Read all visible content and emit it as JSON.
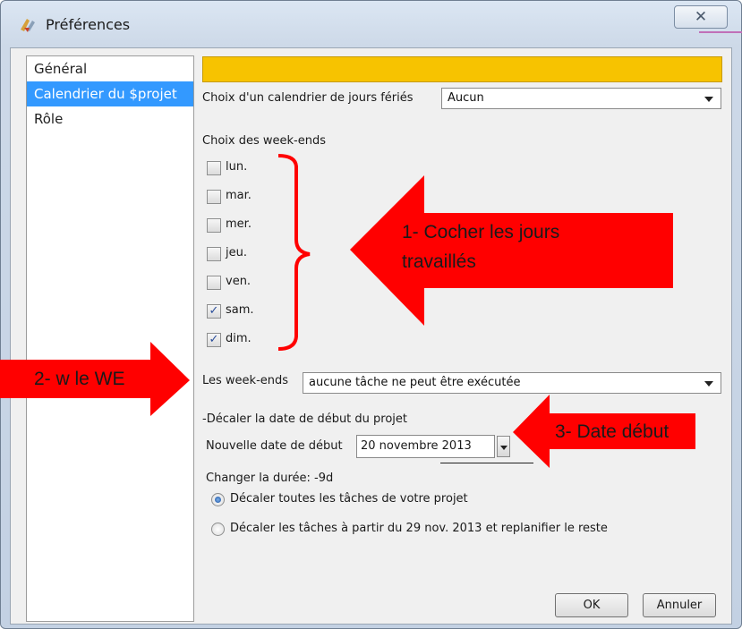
{
  "window": {
    "title": "Préférences",
    "close_glyph": "✕"
  },
  "sidebar": {
    "items": [
      {
        "label": "Général"
      },
      {
        "label": "Calendrier du $projet"
      },
      {
        "label": "Rôle"
      }
    ],
    "selected_index": 1
  },
  "calendar": {
    "holiday_label": "Choix d'un calendrier de jours fériés",
    "holiday_value": "Aucun",
    "weekend_title": "Choix des week-ends",
    "days": [
      {
        "label": "lun.",
        "checked": false
      },
      {
        "label": "mar.",
        "checked": false
      },
      {
        "label": "mer.",
        "checked": false
      },
      {
        "label": "jeu.",
        "checked": false
      },
      {
        "label": "ven.",
        "checked": false
      },
      {
        "label": "sam.",
        "checked": true
      },
      {
        "label": "dim.",
        "checked": true
      }
    ],
    "weekend_mode_label": "Les week-ends",
    "weekend_mode_value": "aucune tâche ne peut être exécutée"
  },
  "shift": {
    "group_title": "-Décaler la date de début du projet",
    "new_date_label": "Nouvelle date de début",
    "new_date_value": "20 novembre 2013",
    "duration_text": "Changer la durée: -9d",
    "options": [
      {
        "label": "Décaler toutes les tâches de votre projet",
        "selected": true
      },
      {
        "label": "Décaler les tâches à partir du 29 nov. 2013 et replanifier le reste",
        "selected": false
      }
    ]
  },
  "buttons": {
    "ok": "OK",
    "cancel": "Annuler"
  },
  "annotations": {
    "arrow1_line1": "1- Cocher les jours",
    "arrow1_line2": "travaillés",
    "arrow2": "2- w le WE",
    "arrow3": "3- Date début"
  },
  "colors": {
    "selection": "#3399ff",
    "yellow_bar": "#f7c300",
    "annotation_red": "#ff0000"
  }
}
